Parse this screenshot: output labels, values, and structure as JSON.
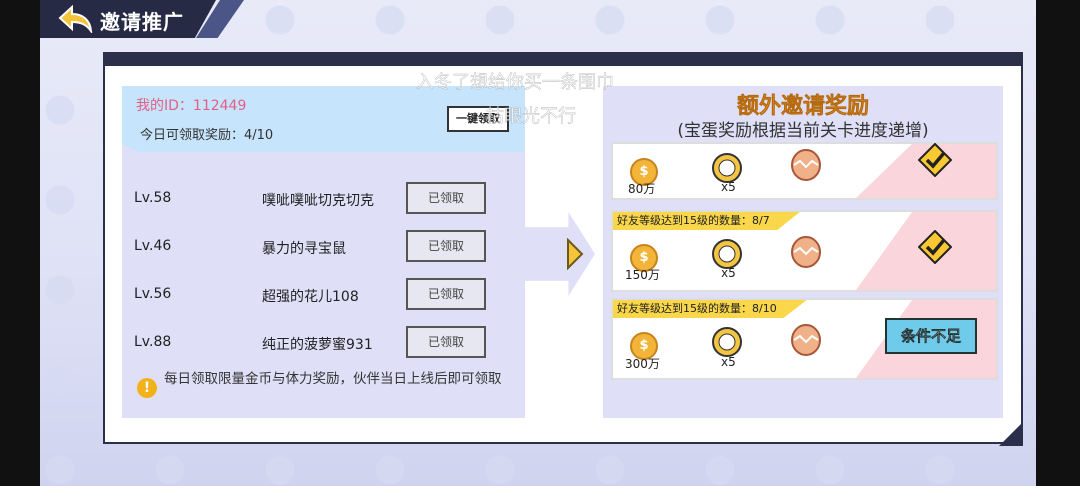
{
  "header": {
    "title": "邀请推广"
  },
  "invite": {
    "my_id": "我的ID：112449",
    "daily_quota": "今日可领取奖励：4/10",
    "claim_all_label": "一键领取"
  },
  "friends": [
    {
      "level": "Lv.58",
      "name": "噗呲噗呲切克切克",
      "status": "已领取"
    },
    {
      "level": "Lv.46",
      "name": "暴力的寻宝鼠",
      "status": "已领取"
    },
    {
      "level": "Lv.56",
      "name": "超强的花儿108",
      "status": "已领取"
    },
    {
      "level": "Lv.88",
      "name": "纯正的菠萝蜜931",
      "status": "已领取"
    }
  ],
  "notice": "每日领取限量金币与体力奖励，伙伴当日上线后即可领取",
  "bonus": {
    "title": "额外邀请奖励",
    "subtitle": "(宝蛋奖励根据当前关卡进度递增)",
    "tiers": [
      {
        "label": "",
        "coins": "80万",
        "pet_qty": "x5",
        "state": "claimed"
      },
      {
        "label": "好友等级达到15级的数量：8/7",
        "coins": "150万",
        "pet_qty": "x5",
        "state": "claimed"
      },
      {
        "label": "好友等级达到15级的数量：8/10",
        "coins": "300万",
        "pet_qty": "x5",
        "state": "insufficient"
      }
    ],
    "insufficient_label": "条件不足"
  },
  "danmaku": [
    "入冬了想给你买一条围巾",
    "枯眼光不行"
  ],
  "colors": {
    "accent": "#f3a22f",
    "id_pink": "#e45f86",
    "label_yellow": "#f9d64a",
    "button_blue": "#6fcbe9"
  }
}
